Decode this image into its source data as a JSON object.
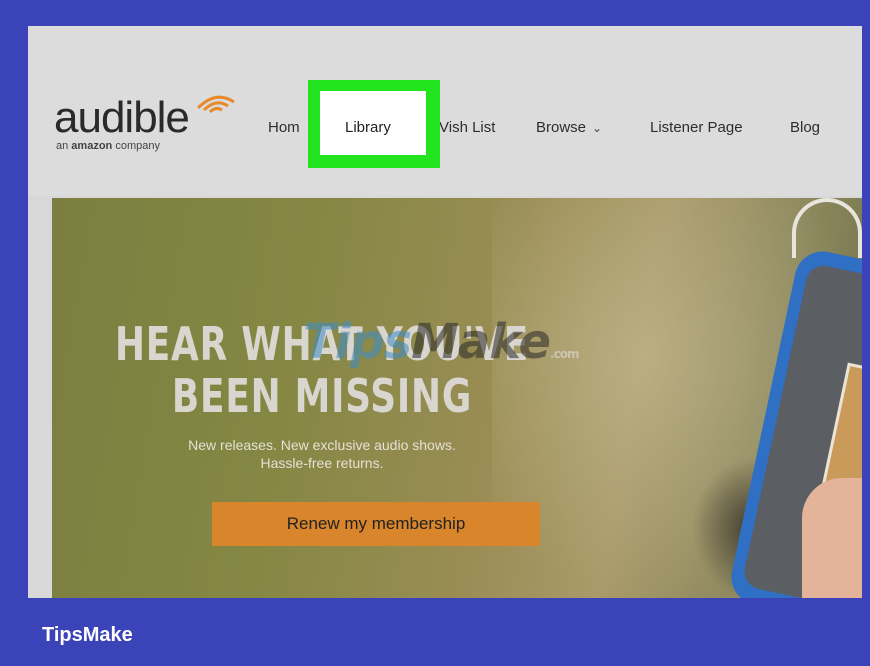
{
  "brand": {
    "logo_word": "audible",
    "logo_sub_prefix": "an ",
    "logo_sub_bold": "amazon",
    "logo_sub_suffix": " company"
  },
  "nav": {
    "home": "Hom",
    "library": "Library",
    "wish_list": "Vish List",
    "browse": "Browse",
    "listener_page": "Listener Page",
    "blog": "Blog"
  },
  "hero": {
    "title_line1": "HEAR WHAT YOU'VE",
    "title_line2": "BEEN MISSING",
    "subtitle_line1": "New releases. New exclusive audio shows.",
    "subtitle_line2": "Hassle-free returns.",
    "cta_label": "Renew my membership"
  },
  "watermark": {
    "part1": "Tips",
    "part2": "Make",
    "domain": ".com"
  },
  "footer": {
    "brand": "TipsMake"
  },
  "colors": {
    "frame_border": "#3b43b8",
    "highlight": "#22e51f",
    "cta": "#d9852b"
  }
}
